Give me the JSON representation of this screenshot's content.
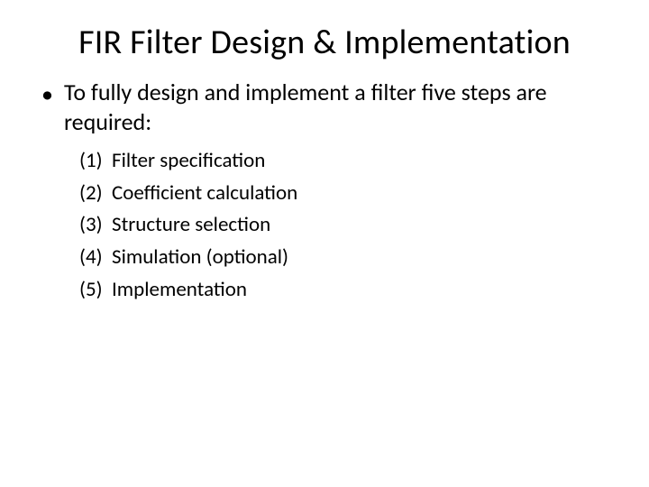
{
  "title": "FIR Filter Design & Implementation",
  "intro": "To fully design and implement a filter five steps are required:",
  "steps": [
    {
      "num": "(1)",
      "text": "Filter specification"
    },
    {
      "num": "(2)",
      "text": "Coefficient calculation"
    },
    {
      "num": "(3)",
      "text": "Structure selection"
    },
    {
      "num": "(4)",
      "text": "Simulation (optional)"
    },
    {
      "num": "(5)",
      "text": "Implementation"
    }
  ]
}
